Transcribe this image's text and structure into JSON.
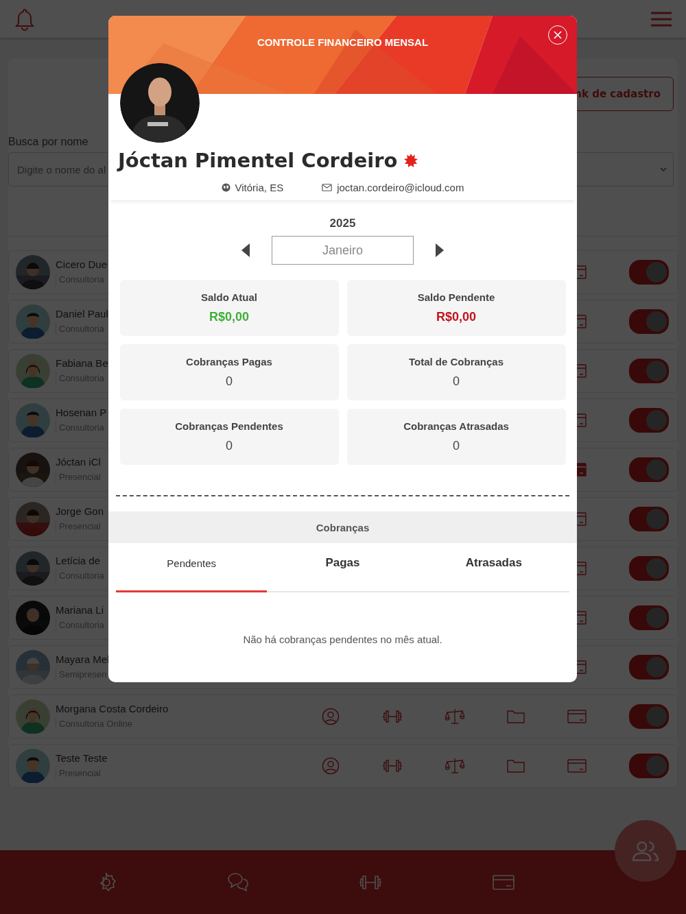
{
  "register_link": {
    "label": "nk de cadastro"
  },
  "search": {
    "label": "Busca por nome",
    "placeholder": "Digite o nome do al"
  },
  "students": [
    {
      "name": "Cicero Due",
      "plan": "Consultoria",
      "covered": true,
      "billing_active": false,
      "on": true
    },
    {
      "name": "Daniel Paul",
      "plan": "Consultoria",
      "kind": "male",
      "covered": true,
      "billing_active": false,
      "on": true
    },
    {
      "name": "Fabiana Be",
      "plan": "Consultoria",
      "kind": "female",
      "covered": true,
      "billing_active": false,
      "on": true
    },
    {
      "name": "Hosenan P",
      "plan": "Consultoria",
      "kind": "male",
      "covered": true,
      "billing_active": false,
      "on": true
    },
    {
      "name": "Jóctan iCl",
      "plan": "Presencial",
      "covered": true,
      "billing_active": true,
      "on": true
    },
    {
      "name": "Jorge  Gon",
      "plan": "Presencial",
      "covered": true,
      "billing_active": false,
      "on": true
    },
    {
      "name": "Letícia  de",
      "plan": "Consultoria",
      "covered": true,
      "billing_active": false,
      "on": true
    },
    {
      "name": "Mariana Li",
      "plan": "Consultoria",
      "covered": true,
      "billing_active": false,
      "on": true
    },
    {
      "name": "Mayara Mel",
      "plan": "Semipresen",
      "covered": true,
      "billing_active": false,
      "on": true
    },
    {
      "name": "Morgana Costa Cordeiro",
      "plan": "Consultoria Online",
      "kind": "female",
      "covered": false,
      "billing_active": false,
      "on": true
    },
    {
      "name": "Teste Teste",
      "plan": "Presencial",
      "kind": "male",
      "covered": false,
      "billing_active": false,
      "on": true
    }
  ],
  "modal": {
    "title": "CONTROLE FINANCEIRO MENSAL",
    "profile": {
      "name": "Jóctan Pimentel Cordeiro",
      "verified": true,
      "location": "Vitória, ES",
      "email": "joctan.cordeiro@icloud.com"
    },
    "year": "2025",
    "month": "Janeiro",
    "stats": [
      {
        "label": "Saldo Atual",
        "value": "R$0,00",
        "kind": "positive"
      },
      {
        "label": "Saldo Pendente",
        "value": "R$0,00",
        "kind": "negative"
      },
      {
        "label": "Cobranças Pagas",
        "value": "0",
        "kind": "neutral"
      },
      {
        "label": "Total de Cobranças",
        "value": "0",
        "kind": "neutral"
      },
      {
        "label": "Cobranças Pendentes",
        "value": "0",
        "kind": "neutral"
      },
      {
        "label": "Cobranças Atrasadas",
        "value": "0",
        "kind": "neutral"
      }
    ],
    "section_title": "Cobranças",
    "tabs": [
      {
        "label": "Pendentes",
        "selected": true
      },
      {
        "label": "Pagas",
        "selected": false
      },
      {
        "label": "Atrasadas",
        "selected": false
      }
    ],
    "empty_message": "Não há cobranças pendentes no mês atual."
  }
}
